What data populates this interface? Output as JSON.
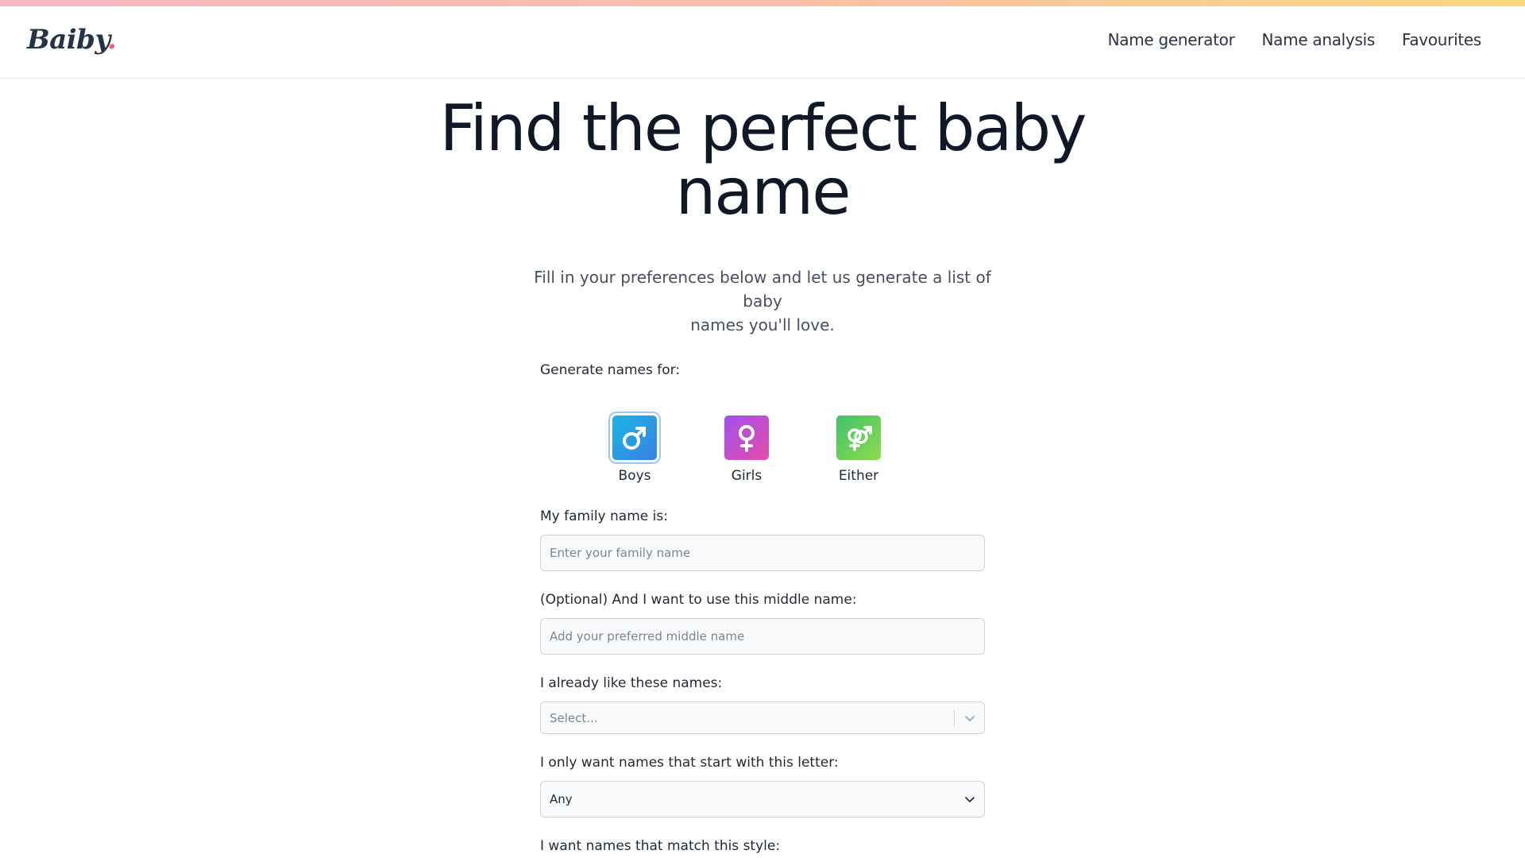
{
  "brand": {
    "name": "Baiby",
    "dot": "."
  },
  "nav": {
    "items": [
      {
        "label": "Name generator"
      },
      {
        "label": "Name analysis"
      },
      {
        "label": "Favourites"
      }
    ]
  },
  "hero": {
    "title_line1": "Find the perfect baby",
    "title_line2": "name",
    "subtitle_line1": "Fill in your preferences below and let us generate a list of baby",
    "subtitle_line2": "names you'll love."
  },
  "form": {
    "gender_label": "Generate names for:",
    "genders": [
      {
        "label": "Boys",
        "icon": "male-icon",
        "selected": true
      },
      {
        "label": "Girls",
        "icon": "female-icon",
        "selected": false
      },
      {
        "label": "Either",
        "icon": "male-female-icon",
        "selected": false
      }
    ],
    "family_name": {
      "label": "My family name is:",
      "placeholder": "Enter your family name",
      "value": ""
    },
    "middle_name": {
      "label": "(Optional) And I want to use this middle name:",
      "placeholder": "Add your preferred middle name",
      "value": ""
    },
    "liked_names": {
      "label": "I already like these names:",
      "placeholder": "Select..."
    },
    "start_letter": {
      "label": "I only want names that start with this letter:",
      "value": "Any"
    },
    "style": {
      "label": "I want names that match this style:"
    }
  },
  "colors": {
    "accent_boys": "#2a9be6",
    "accent_girls": "#c24ccf",
    "accent_either": "#5acb5b",
    "logo_dot": "#f06277",
    "title": "#101828"
  }
}
